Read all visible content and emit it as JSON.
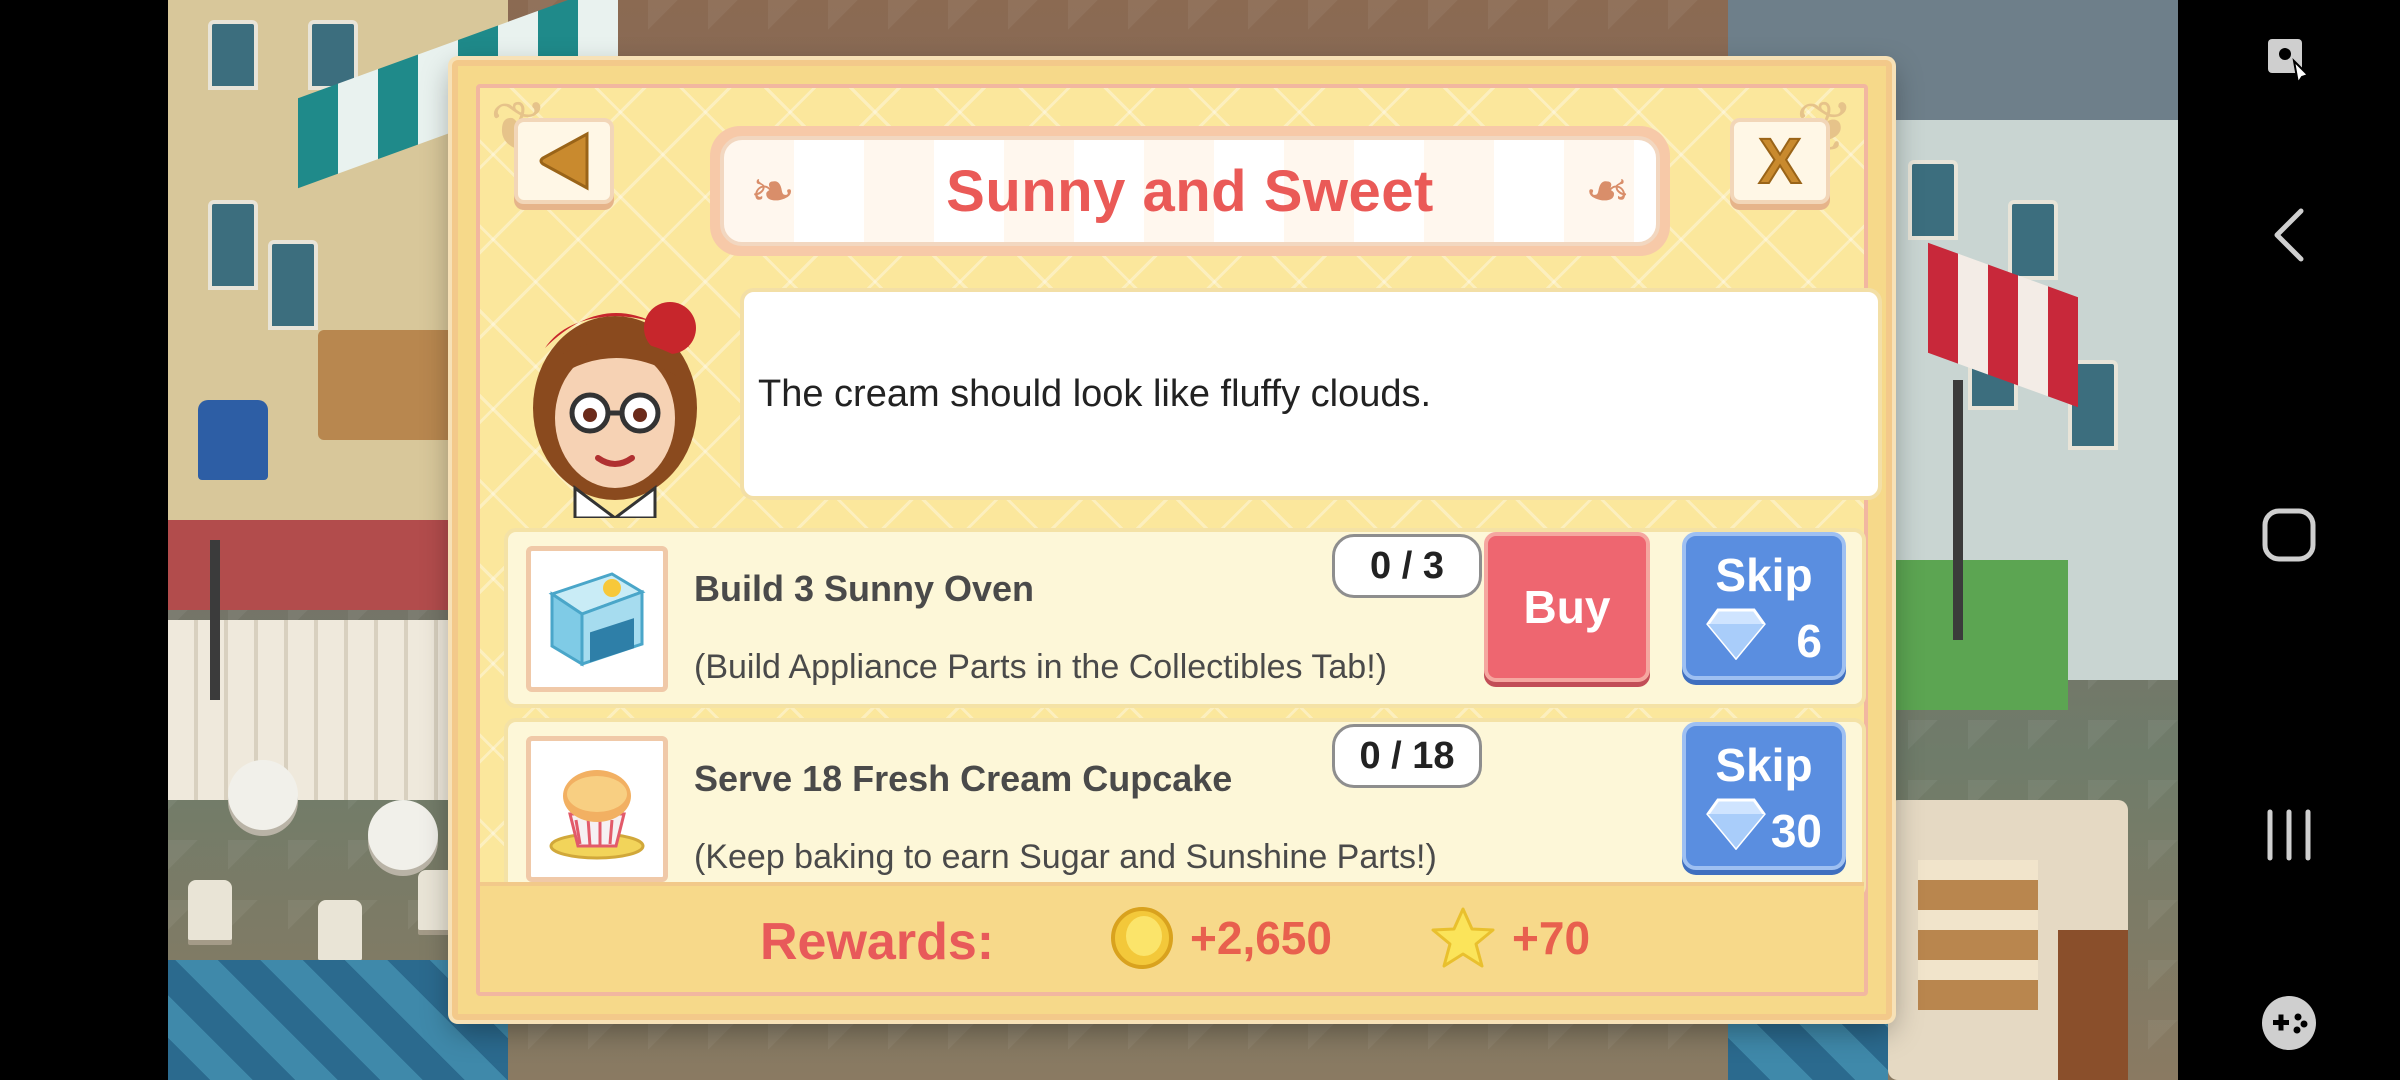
{
  "dialog": {
    "title": "Sunny and Sweet",
    "back_icon": "triangle-left-icon",
    "close_label": "X",
    "speech": "The cream should look like fluffy clouds."
  },
  "tasks": [
    {
      "title": "Build 3 Sunny Oven",
      "hint": "(Build Appliance Parts in the Collectibles Tab!)",
      "progress": "0 / 3",
      "buy_label": "Buy",
      "skip_label": "Skip",
      "skip_cost": "6",
      "icon": "sunny-oven-icon"
    },
    {
      "title": "Serve 18 Fresh Cream Cupcake",
      "hint": "(Keep baking to earn Sugar and Sunshine Parts!)",
      "progress": "0 / 18",
      "skip_label": "Skip",
      "skip_cost": "30",
      "icon": "cupcake-icon"
    }
  ],
  "rewards": {
    "label": "Rewards:",
    "coins": "+2,650",
    "stars": "+70"
  },
  "colors": {
    "title": "#ea5a57",
    "buy": "#ee6670",
    "skip": "#5a8ee0",
    "panel": "#fbe79c"
  }
}
